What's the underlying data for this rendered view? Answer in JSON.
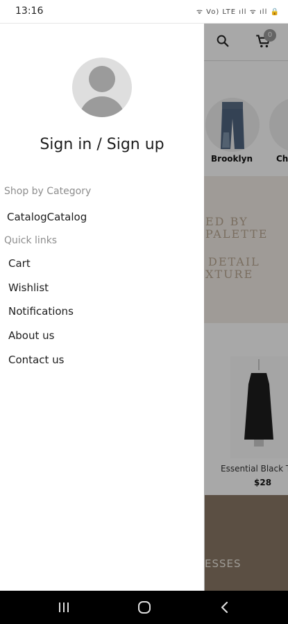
{
  "status_bar": {
    "time": "13:16",
    "icons_text": "ᯤ Vo) LTE ıll ᯤ ıll 🔒"
  },
  "background": {
    "cart_badge": "0",
    "categories": [
      {
        "label": "Brooklyn"
      },
      {
        "label": "Ch"
      }
    ],
    "banner_lines": [
      "ED BY",
      "PALETTE",
      "DETAIL",
      "XTURE"
    ],
    "product": {
      "name": "Essential Black T",
      "price": "$28"
    },
    "bottom_text": "ESSES"
  },
  "drawer": {
    "sign_in_label": "Sign in / Sign up",
    "shop_section_title": "Shop by Category",
    "shop_items": [
      {
        "label": "CatalogCatalog"
      }
    ],
    "quick_section_title": "Quick links",
    "quick_items": [
      {
        "label": "Cart"
      },
      {
        "label": "Wishlist"
      },
      {
        "label": "Notifications"
      },
      {
        "label": "About us"
      },
      {
        "label": "Contact us"
      }
    ]
  },
  "colors": {
    "scrim": "#000000",
    "text_primary": "#1c1c1c",
    "text_secondary": "#8d8d8d"
  }
}
